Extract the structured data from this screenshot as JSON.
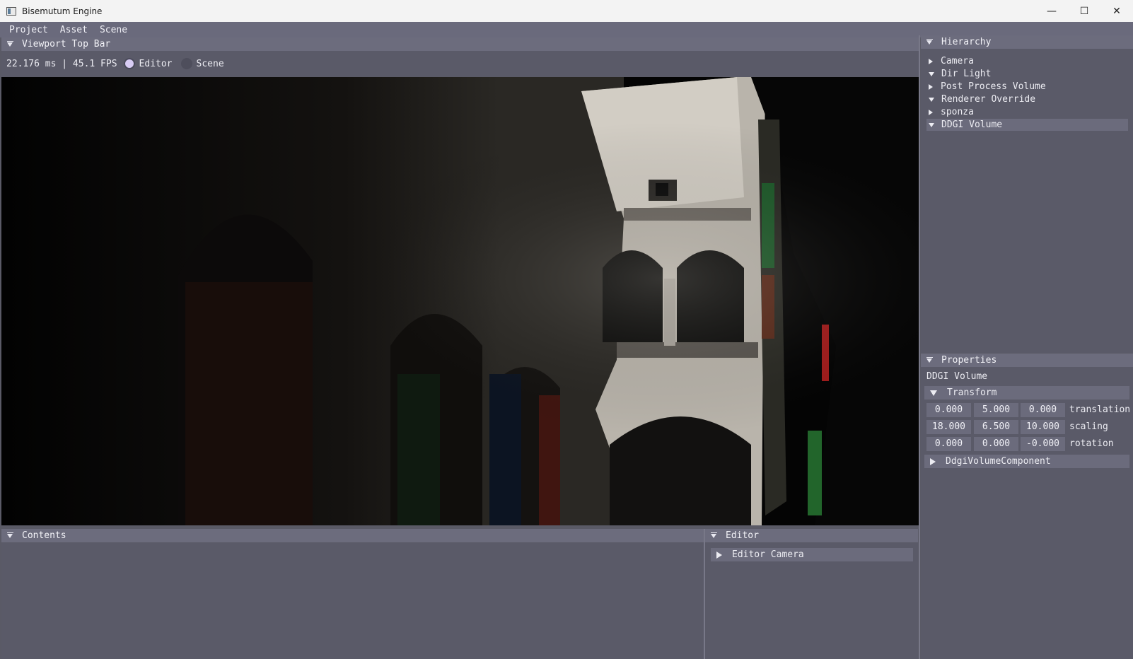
{
  "window": {
    "title": "Bisemutum Engine",
    "minimize": "—",
    "maximize": "☐",
    "close": "✕"
  },
  "menu": [
    "Project",
    "Asset",
    "Scene"
  ],
  "viewport": {
    "panel_title": "Viewport Top Bar",
    "perf": "22.176 ms | 45.1 FPS",
    "modes": [
      {
        "label": "Editor",
        "selected": true
      },
      {
        "label": "Scene",
        "selected": false
      }
    ]
  },
  "hierarchy": {
    "title": "Hierarchy",
    "items": [
      {
        "label": "Camera",
        "expanded": false,
        "selected": false
      },
      {
        "label": "Dir Light",
        "expanded": true,
        "selected": false
      },
      {
        "label": "Post Process Volume",
        "expanded": false,
        "selected": false
      },
      {
        "label": "Renderer Override",
        "expanded": true,
        "selected": false
      },
      {
        "label": "sponza",
        "expanded": false,
        "selected": false
      },
      {
        "label": "DDGI Volume",
        "expanded": true,
        "selected": true
      }
    ]
  },
  "properties": {
    "title": "Properties",
    "entity_name": "DDGI Volume",
    "transform": {
      "label": "Transform",
      "translation": {
        "label": "translation",
        "values": [
          "0.000",
          "5.000",
          "0.000"
        ]
      },
      "scaling": {
        "label": "scaling",
        "values": [
          "18.000",
          "6.500",
          "10.000"
        ]
      },
      "rotation": {
        "label": "rotation",
        "values": [
          "0.000",
          "0.000",
          "-0.000"
        ]
      }
    },
    "component": "DdgiVolumeComponent"
  },
  "contents": {
    "title": "Contents"
  },
  "editor": {
    "title": "Editor",
    "camera_section": "Editor Camera"
  },
  "icons": [
    "app-icon",
    "minimize-icon",
    "maximize-icon",
    "close-icon",
    "collapse-icon",
    "tree-arrow-icon"
  ],
  "colors": {
    "panel_bg": "#5a5a68",
    "header_bg": "#6c6c7d",
    "selected_radio": "#d8ccf4"
  }
}
